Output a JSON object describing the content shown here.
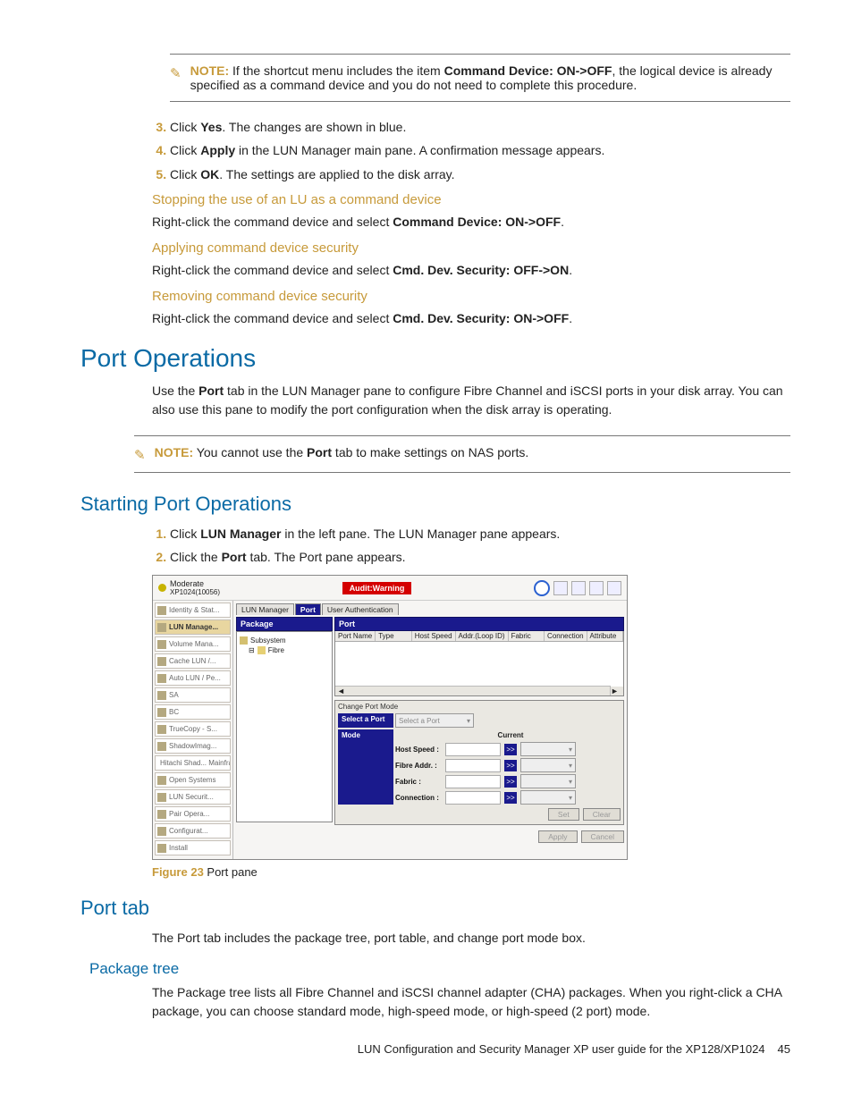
{
  "note1": {
    "label": "NOTE:",
    "text_a": "If the shortcut menu includes the item ",
    "bold": "Command Device: ON->OFF",
    "text_b": ", the logical device is already specified as a command device and you do not need to complete this procedure."
  },
  "steps1": {
    "s3a": "Click ",
    "s3b": "Yes",
    "s3c": ". The changes are shown in blue.",
    "s4a": "Click ",
    "s4b": "Apply",
    "s4c": " in the LUN Manager main pane. A confirmation message appears.",
    "s5a": "Click ",
    "s5b": "OK",
    "s5c": ". The settings are applied to the disk array."
  },
  "sub1": {
    "h": "Stopping the use of an LU as a command device",
    "pa": "Right-click the command device and select ",
    "pb": "Command Device: ON->OFF",
    "pc": "."
  },
  "sub2": {
    "h": "Applying command device security",
    "pa": "Right-click the command device and select ",
    "pb": "Cmd. Dev. Security: OFF->ON",
    "pc": "."
  },
  "sub3": {
    "h": "Removing command device security",
    "pa": "Right-click the command device and select ",
    "pb": "Cmd. Dev. Security: ON->OFF",
    "pc": "."
  },
  "h1": "Port Operations",
  "p_port_a": "Use the ",
  "p_port_b": "Port",
  "p_port_c": " tab in the LUN Manager pane to configure Fibre Channel and iSCSI ports in your disk array. You can also use this pane to modify the port configuration when the disk array is operating.",
  "note2": {
    "label": "NOTE:",
    "ta": "You cannot use the ",
    "tb": "Port",
    "tc": " tab to make settings on NAS ports."
  },
  "h2_start": "Starting Port Operations",
  "steps2": {
    "s1a": "Click ",
    "s1b": "LUN Manager",
    "s1c": " in the left pane. The LUN Manager pane appears.",
    "s2a": "Click the ",
    "s2b": "Port",
    "s2c": " tab. The Port pane appears."
  },
  "fig": {
    "label": "Figure 23",
    "text": " Port pane"
  },
  "h2_porttab": "Port tab",
  "p_porttab": "The Port tab includes the package tree, port table, and change port mode box.",
  "h3_pkg": "Package tree",
  "p_pkg": "The Package tree lists all Fibre Channel and iSCSI channel adapter (CHA) packages. When you right-click a CHA package, you can choose standard mode, high-speed mode, or high-speed (2 port) mode.",
  "footer": {
    "title": "LUN Configuration and Security Manager XP user guide for the XP128/XP1024",
    "page": "45"
  },
  "ss": {
    "status": "Moderate",
    "device": "XP1024(10056)",
    "audit": "Audit:Warning",
    "leftnav": [
      "Identity & Stat...",
      "LUN Manage...",
      "Volume Mana...",
      "Cache LUN /...",
      "Auto LUN / Pe...",
      "SA",
      "BC",
      "TrueCopy - S...",
      "ShadowImag...",
      "Hitachi Shad... Mainframe",
      "Open Systems",
      "LUN Securit...",
      "Pair Opera...",
      "Configurat...",
      "Install"
    ],
    "selnav_index": 1,
    "tabs": [
      "LUN Manager",
      "Port",
      "User Authentication"
    ],
    "pkg_hdr": "Package",
    "port_hdr": "Port",
    "tree": {
      "root": "Subsystem",
      "child": "Fibre"
    },
    "cols": [
      "Port Name",
      "Type",
      "Host Speed",
      "Addr.(Loop ID)",
      "Fabric",
      "Connection",
      "Attribute"
    ],
    "chg_title": "Change Port Mode",
    "select_lbl": "Select a Port",
    "select_ph": "Select a Port",
    "mode_lbl": "Mode",
    "current_lbl": "Current",
    "rows": [
      "Host Speed :",
      "Fibre Addr. :",
      "Fabric :",
      "Connection :"
    ],
    "arrow": ">>",
    "btns": [
      "Set",
      "Clear",
      "Apply",
      "Cancel"
    ]
  }
}
